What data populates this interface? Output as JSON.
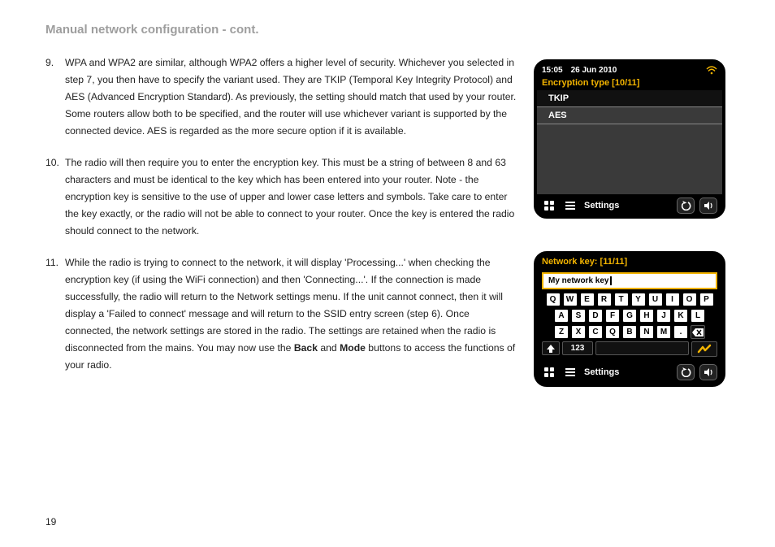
{
  "title": "Manual network configuration - cont.",
  "page_number": "19",
  "paragraphs": {
    "p9": {
      "num": "9.",
      "text": "WPA and WPA2 are similar, although WPA2 offers a higher level of security. Whichever you selected in step 7, you then have to specify the variant used. They are TKIP (Temporal Key Integrity Protocol) and AES (Advanced Encryption Standard). As previously, the setting should match that used by your router. Some routers allow both to be specified, and the router will use whichever variant is supported by the connected device. AES is regarded as the more secure option if it is available."
    },
    "p10": {
      "num": "10.",
      "text": "The radio will then require you to enter the encryption key. This must be a string of between 8 and 63 characters and must be identical to the key which has been entered into your router. Note - the encryption key is sensitive to the use of upper and lower case letters and symbols. Take care to enter the key exactly, or the radio will not be able to connect to your router. Once the key is entered the radio should connect to the network."
    },
    "p11": {
      "num": "11.",
      "pre": "While the radio is trying to connect to the network, it will display 'Processing...' when checking the encryption key (if using the WiFi connection) and then 'Connecting...'. If the connection is made successfully, the radio will return to the Network settings menu. If the unit cannot connect, then it will display a 'Failed to connect' message and will return to the SSID entry screen (step 6). Once connected, the network settings are stored in the radio. The settings are retained when the radio is disconnected from the mains. You may now use the ",
      "bold1": "Back",
      "mid": " and ",
      "bold2": "Mode",
      "post": " buttons to access the functions of your radio."
    }
  },
  "screen1": {
    "time": "15:05",
    "date": "26 Jun 2010",
    "heading": "Encryption type [10/11]",
    "items": [
      "TKIP",
      "AES"
    ],
    "footer_label": "Settings"
  },
  "screen2": {
    "heading": "Network key: [11/11]",
    "field_value": "My network key",
    "rows": [
      [
        "Q",
        "W",
        "E",
        "R",
        "T",
        "Y",
        "U",
        "I",
        "O",
        "P"
      ],
      [
        "A",
        "S",
        "D",
        "F",
        "G",
        "H",
        "J",
        "K",
        "L"
      ],
      [
        "Z",
        "X",
        "C",
        "Q",
        "B",
        "N",
        "M",
        "."
      ]
    ],
    "numkey": "123",
    "footer_label": "Settings"
  }
}
